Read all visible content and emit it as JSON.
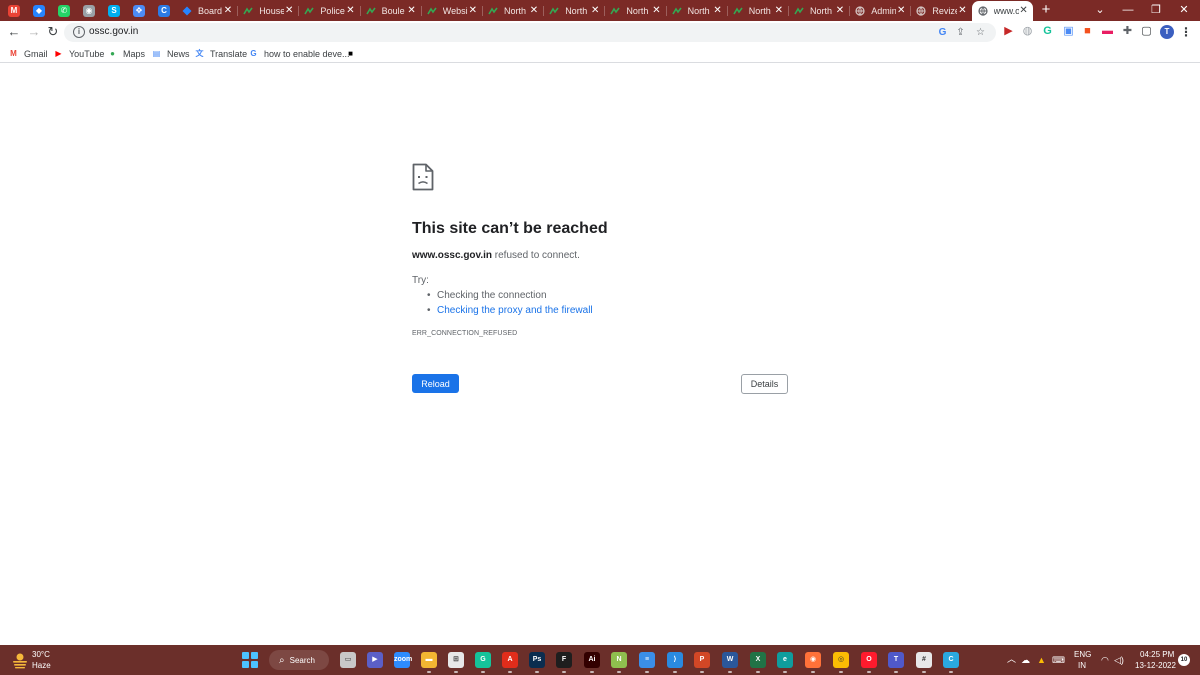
{
  "pinned_tabs": [
    {
      "icon": "gmail-icon",
      "glyph": "M",
      "color": "#ea4335"
    },
    {
      "icon": "jira-icon",
      "glyph": "◆",
      "color": "#2684ff"
    },
    {
      "icon": "whatsapp-icon",
      "glyph": "✆",
      "color": "#25d366"
    },
    {
      "icon": "messenger-icon",
      "glyph": "◉",
      "color": "#9aa0a6"
    },
    {
      "icon": "skype-icon",
      "glyph": "S",
      "color": "#00aff0"
    },
    {
      "icon": "cursor-icon",
      "glyph": "✥",
      "color": "#4c8bf5"
    },
    {
      "icon": "c-logo-icon",
      "glyph": "C",
      "color": "#2c7be5"
    }
  ],
  "tabs": [
    {
      "title": "Board",
      "icon": "jira-icon"
    },
    {
      "title": "House",
      "icon": "sheets-icon"
    },
    {
      "title": "Police",
      "icon": "sheets-icon"
    },
    {
      "title": "Boule",
      "icon": "sheets-icon"
    },
    {
      "title": "Websi",
      "icon": "sheets-icon"
    },
    {
      "title": "North",
      "icon": "sheets-icon"
    },
    {
      "title": "North",
      "icon": "sheets-icon"
    },
    {
      "title": "North",
      "icon": "sheets-icon"
    },
    {
      "title": "North",
      "icon": "sheets-icon"
    },
    {
      "title": "North",
      "icon": "sheets-icon"
    },
    {
      "title": "North",
      "icon": "sheets-icon"
    },
    {
      "title": "Admin",
      "icon": "globe-icon"
    },
    {
      "title": "Revize",
      "icon": "globe-icon"
    },
    {
      "title": "www.o",
      "icon": "globe-icon",
      "active": true
    }
  ],
  "tab_close_glyph": "✕",
  "new_tab_glyph": "+",
  "window_controls": [
    "⌄",
    "—",
    "❐",
    "✕"
  ],
  "toolbar": {
    "back_glyph": "←",
    "forward_glyph": "→",
    "reload_glyph": "↻",
    "url": "ossc.gov.in",
    "info_glyph": "i",
    "google_glyph": "G",
    "share_glyph": "⇪",
    "star_glyph": "☆",
    "extension_glyphs": [
      "▶",
      "◍",
      "G",
      "▣",
      "■",
      "▬",
      "✚",
      "▢"
    ],
    "profile_initial": "T",
    "menu_glyph": "⋮"
  },
  "bookmarks": [
    {
      "label": "Gmail",
      "glyph": "M",
      "color": "#ea4335"
    },
    {
      "label": "YouTube",
      "glyph": "▶",
      "color": "#ff0000"
    },
    {
      "label": "Maps",
      "glyph": "●",
      "color": "#34a853"
    },
    {
      "label": "News",
      "glyph": "▤",
      "color": "#4285f4"
    },
    {
      "label": "Translate",
      "glyph": "文",
      "color": "#4285f4"
    },
    {
      "label": "how to enable deve...",
      "glyph": "G",
      "color": "#4285f4"
    },
    {
      "label": "",
      "glyph": "■",
      "color": "#000000"
    }
  ],
  "error": {
    "headline": "This site can’t be reached",
    "host": "www.ossc.gov.in",
    "summary_rest": " refused to connect.",
    "try_label": "Try:",
    "suggestions": [
      "Checking the connection",
      "Checking the proxy and the firewall"
    ],
    "error_code": "ERR_CONNECTION_REFUSED",
    "reload_label": "Reload",
    "details_label": "Details"
  },
  "taskbar": {
    "temperature": "30°C",
    "condition": "Haze",
    "search_label": "Search",
    "search_glyph": "⌕",
    "apps": [
      {
        "name": "file-viewer-icon",
        "glyph": "▭",
        "color": "#c8c8c8"
      },
      {
        "name": "meet-icon",
        "glyph": "▶",
        "color": "#5b5fc7"
      },
      {
        "name": "zoom-icon",
        "glyph": "zoom",
        "color": "#2d8cff"
      },
      {
        "name": "folder-icon",
        "glyph": "▬",
        "color": "#f2b632"
      },
      {
        "name": "store-icon",
        "glyph": "⊞",
        "color": "#e8e8e8"
      },
      {
        "name": "grammarly-icon",
        "glyph": "G",
        "color": "#15c39a"
      },
      {
        "name": "acrobat-icon",
        "glyph": "A",
        "color": "#e02d1b"
      },
      {
        "name": "photoshop-icon",
        "glyph": "Ps",
        "color": "#0b2d4f"
      },
      {
        "name": "figma-icon",
        "glyph": "F",
        "color": "#1e1e1e"
      },
      {
        "name": "illustrator-icon",
        "glyph": "Ai",
        "color": "#330000"
      },
      {
        "name": "notepadpp-icon",
        "glyph": "N",
        "color": "#8fbf4e"
      },
      {
        "name": "notepad-icon",
        "glyph": "≡",
        "color": "#3b8ee8"
      },
      {
        "name": "vscode-icon",
        "glyph": "⟩",
        "color": "#2a8ae0"
      },
      {
        "name": "powerpoint-icon",
        "glyph": "P",
        "color": "#d24726"
      },
      {
        "name": "word-icon",
        "glyph": "W",
        "color": "#2b579a"
      },
      {
        "name": "excel-icon",
        "glyph": "X",
        "color": "#217346"
      },
      {
        "name": "edge-icon",
        "glyph": "e",
        "color": "#0f9d9d"
      },
      {
        "name": "firefox-icon",
        "glyph": "◉",
        "color": "#ff7139"
      },
      {
        "name": "chrome-icon",
        "glyph": "◎",
        "color": "#fbbc04"
      },
      {
        "name": "opera-icon",
        "glyph": "O",
        "color": "#ff1b2d"
      },
      {
        "name": "teams-icon",
        "glyph": "T",
        "color": "#5059c9"
      },
      {
        "name": "slack-icon",
        "glyph": "#",
        "color": "#e8e8e8"
      },
      {
        "name": "c-app-icon",
        "glyph": "C",
        "color": "#2aa9e0"
      }
    ],
    "tray": {
      "chevron_glyph": "︿",
      "weather_glyph": "☁",
      "drive_glyph": "▲",
      "keyboard_glyph": "⌨",
      "lang_1": "ENG",
      "lang_2": "IN",
      "wifi_glyph": "◠",
      "volume_glyph": "◁)",
      "time": "04:25 PM",
      "date": "13-12-2022",
      "notifications": "10"
    }
  }
}
